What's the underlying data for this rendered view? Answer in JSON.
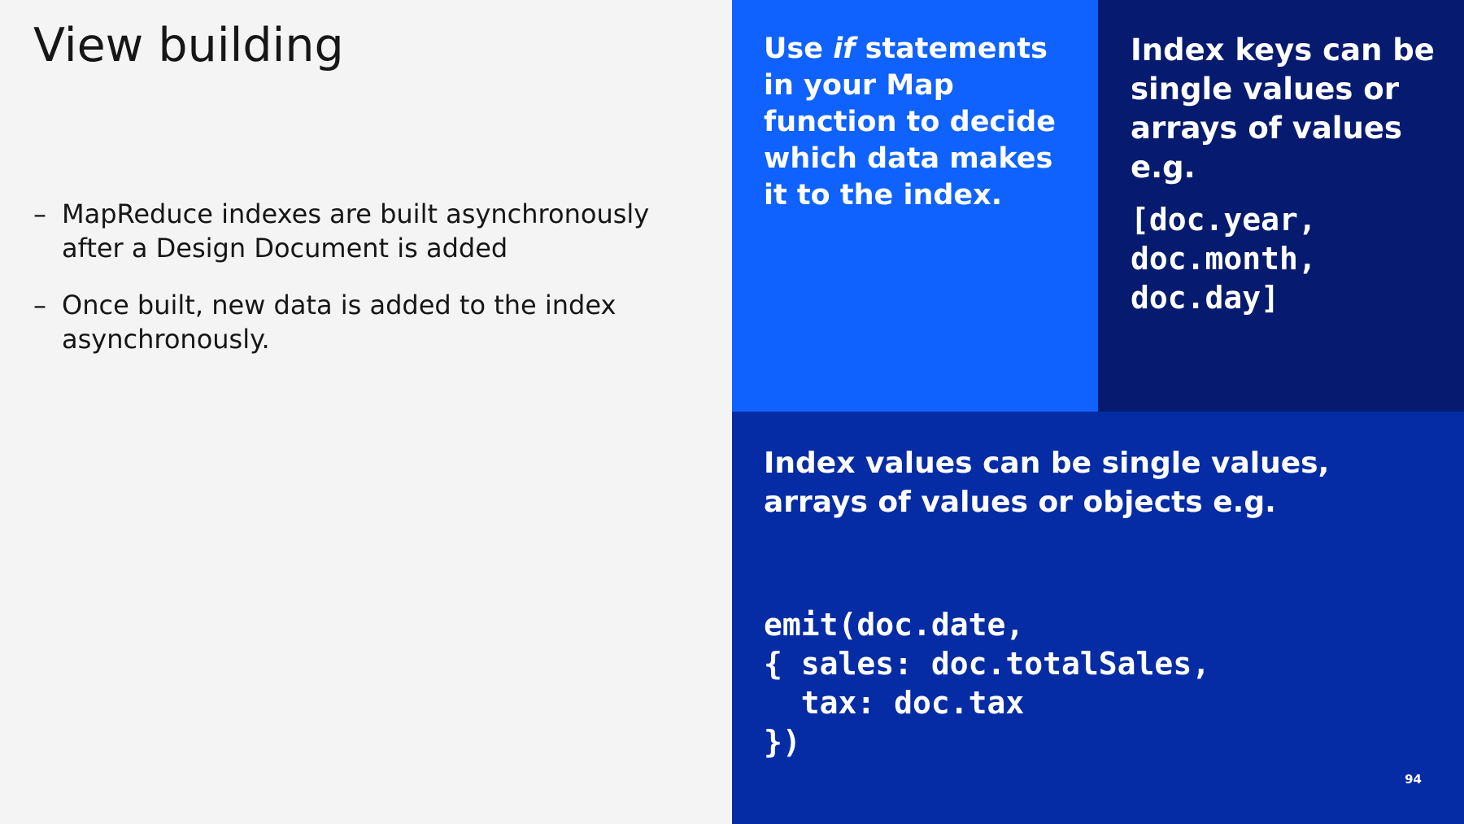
{
  "slide": {
    "title": "View building",
    "bullets": [
      "MapReduce indexes are built asynchronously after a Design Document is added",
      "Once built, new data is added to the index asynchronously."
    ],
    "bullet_marker": "–",
    "panel_a": {
      "text_before": "Use ",
      "text_italic": "if",
      "text_after": " statements in your Map function to decide which data makes it to the index."
    },
    "panel_b": {
      "text": "Index keys can be single values or arrays of values e.g.",
      "code": "[doc.year,\ndoc.month,\ndoc.day]"
    },
    "panel_c": {
      "text": "Index values can be single values, arrays of values or objects e.g.",
      "code": "emit(doc.date,\n{ sales: doc.totalSales,\n  tax: doc.tax\n})"
    },
    "page_number": "94"
  },
  "colors": {
    "background": "#f4f4f4",
    "panel_a": "#0f62fe",
    "panel_b": "#061b6f",
    "panel_c": "#052ca5",
    "text_dark": "#161616",
    "text_light": "#ffffff"
  }
}
